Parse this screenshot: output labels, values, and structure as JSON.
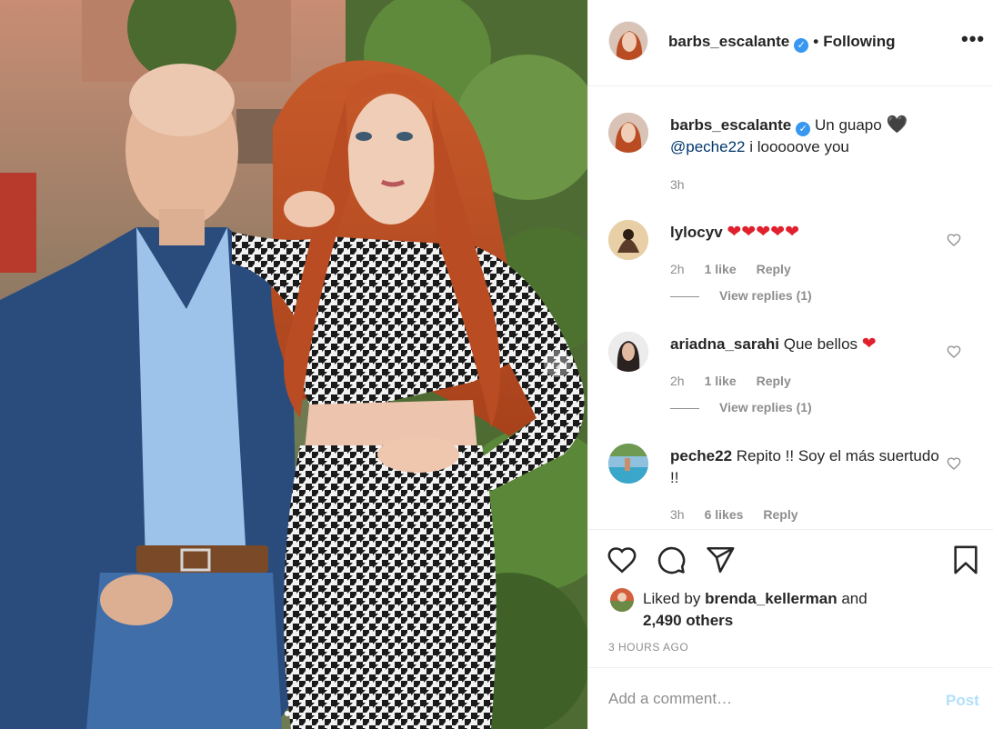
{
  "post": {
    "author": "barbs_escalante",
    "separator": "•",
    "follow_status": "Following",
    "more_label": "•••",
    "verified_mark": "✓",
    "caption": {
      "user": "barbs_escalante",
      "text": "Un guapo",
      "emoji": "🖤",
      "mention": "@peche22",
      "text2": "i looooove you",
      "time": "3h"
    }
  },
  "comments": [
    {
      "user": "lylocyv",
      "text": "",
      "emoji": "❤❤❤❤❤",
      "time": "2h",
      "likes": "1 like",
      "reply_label": "Reply",
      "view_replies": "View replies (1)"
    },
    {
      "user": "ariadna_sarahi",
      "text": "Que bellos",
      "emoji": "❤",
      "time": "2h",
      "likes": "1 like",
      "reply_label": "Reply",
      "view_replies": "View replies (1)"
    },
    {
      "user": "peche22",
      "text": "Repito !! Soy el más suertudo !!",
      "emoji": "",
      "time": "3h",
      "likes": "6 likes",
      "reply_label": "Reply",
      "view_replies": ""
    }
  ],
  "actions": {
    "icons": [
      "heart-icon",
      "comment-icon",
      "share-icon",
      "bookmark-icon"
    ],
    "liked_by_prefix": "Liked by",
    "liked_by_user": "brenda_kellerman",
    "liked_by_and": "and",
    "liked_by_others": "2,490 others",
    "timestamp": "3 HOURS AGO"
  },
  "add_comment": {
    "placeholder": "Add a comment…",
    "post_label": "Post"
  },
  "colors": {
    "verified": "#3897f0",
    "link": "#00376b",
    "muted": "#8e8e8e",
    "post_disabled": "#b2dffc",
    "heart_red": "#e0202d"
  }
}
